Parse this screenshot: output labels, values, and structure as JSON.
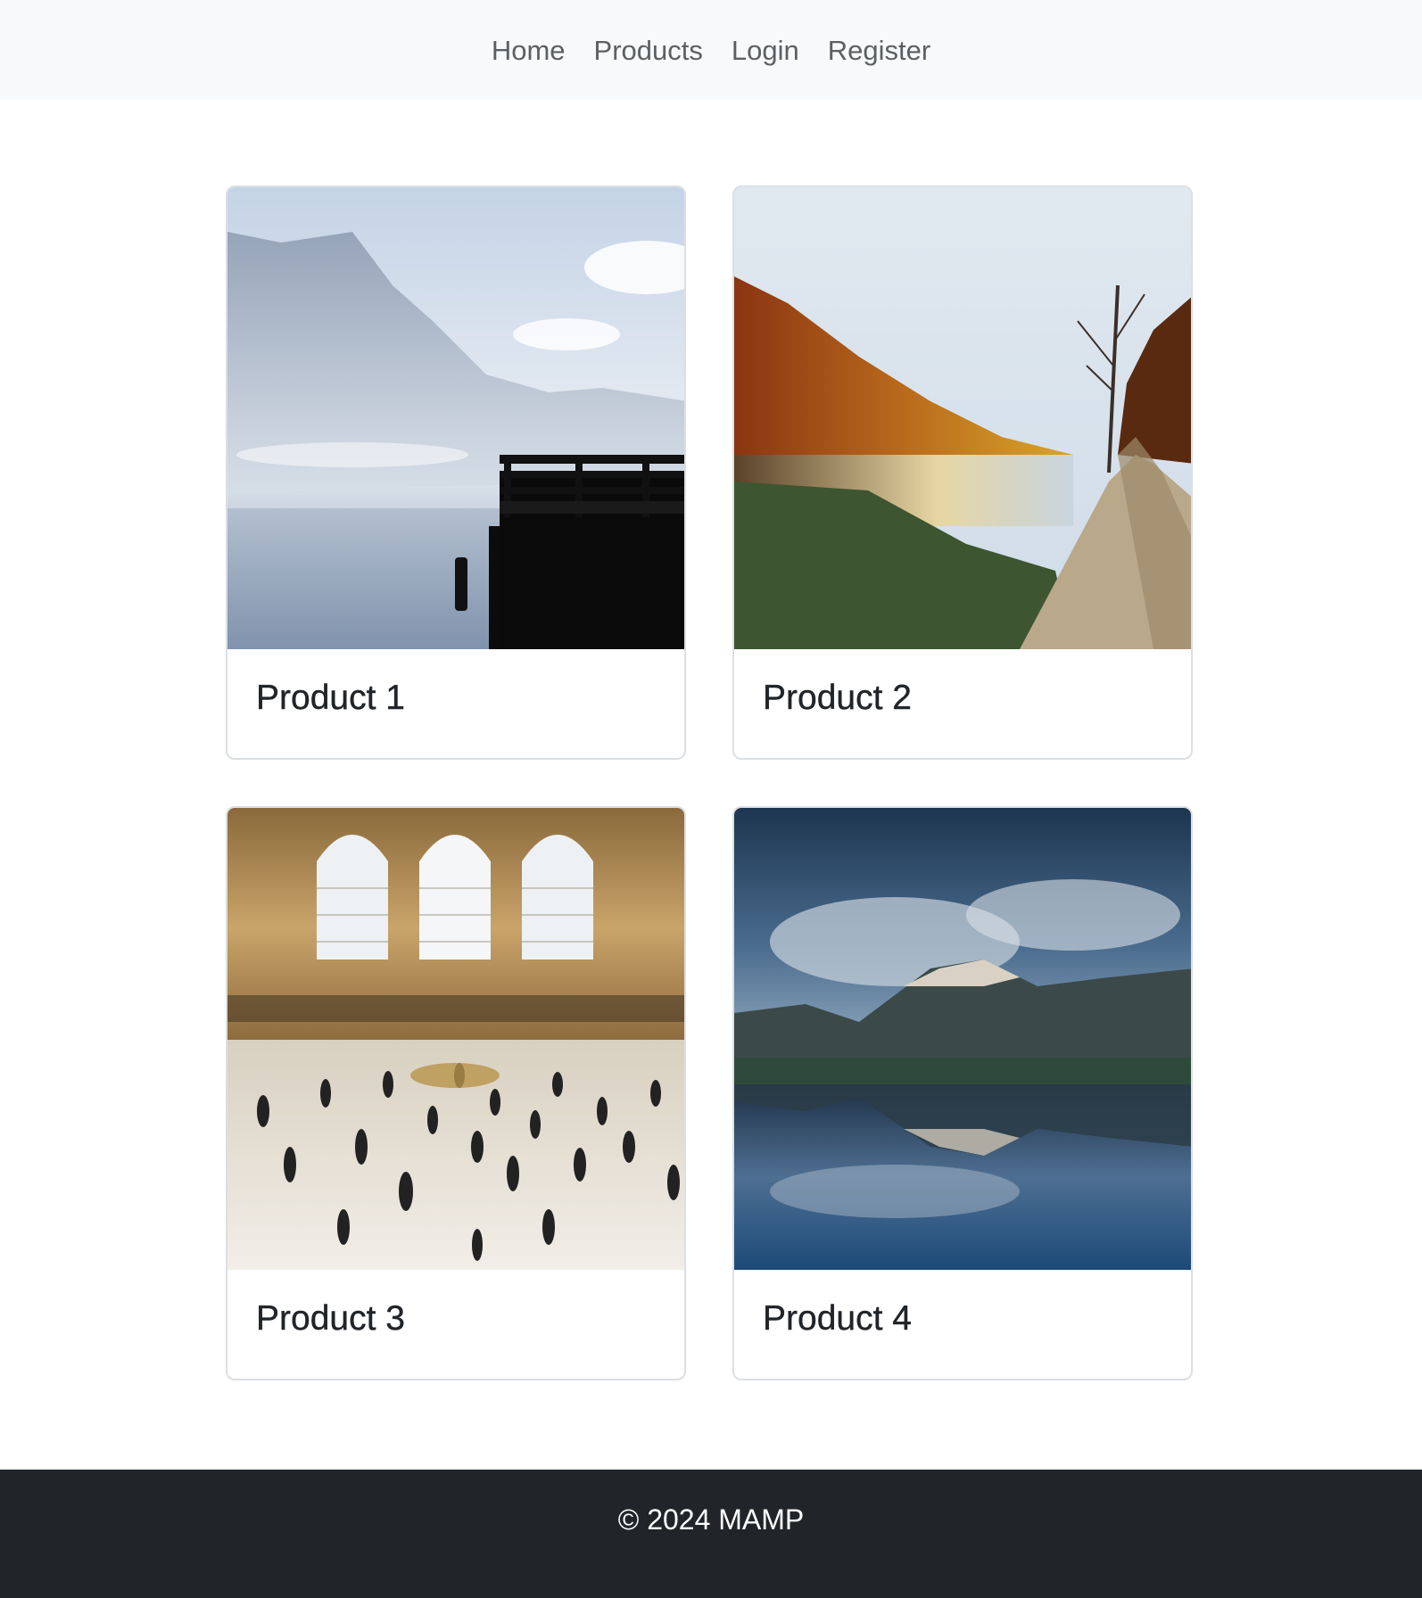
{
  "nav": {
    "items": [
      {
        "label": "Home"
      },
      {
        "label": "Products"
      },
      {
        "label": "Login"
      },
      {
        "label": "Register"
      }
    ]
  },
  "products": [
    {
      "title": "Product 1",
      "image": "misty-lake-pier-photo"
    },
    {
      "title": "Product 2",
      "image": "autumn-lake-road-photo"
    },
    {
      "title": "Product 3",
      "image": "station-concourse-crowd-photo"
    },
    {
      "title": "Product 4",
      "image": "mountain-lake-reflection-photo"
    }
  ],
  "footer": {
    "text": "© 2024 MAMP"
  },
  "colors": {
    "navbar_bg": "#f8f9fa",
    "footer_bg": "#212529",
    "nav_text": "#5c6064",
    "card_border": "#dcdfe3"
  }
}
